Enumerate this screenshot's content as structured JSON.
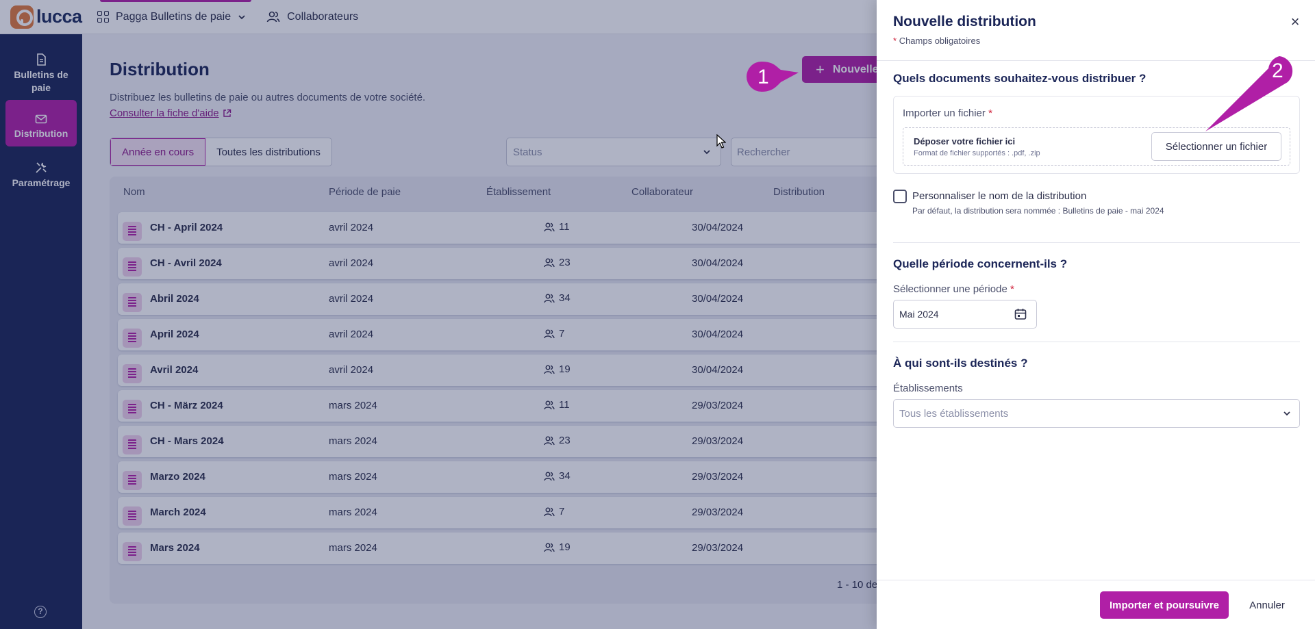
{
  "brand": {
    "logo_text": "lucca"
  },
  "topnav": {
    "app_label": "Pagga Bulletins de paie",
    "collab_label": "Collaborateurs"
  },
  "sidebar": {
    "items": [
      {
        "label": "Bulletins de paie",
        "icon": "document-icon"
      },
      {
        "label": "Distribution",
        "icon": "envelope-icon"
      },
      {
        "label": "Paramétrage",
        "icon": "tools-icon"
      }
    ],
    "help_glyph": "?"
  },
  "page": {
    "title": "Distribution",
    "description": "Distribuez les bulletins de paie ou autres documents de votre société.",
    "help_link": "Consulter la fiche d'aide",
    "new_button": "Nouvelle distribution"
  },
  "filters": {
    "seg_current": "Année en cours",
    "seg_all": "Toutes les distributions",
    "status_placeholder": "Status",
    "search_placeholder": "Rechercher"
  },
  "table": {
    "headers": {
      "name": "Nom",
      "period": "Période de paie",
      "etab": "Établissement",
      "collab": "Collaborateur",
      "dist": "Distribution"
    },
    "rows": [
      {
        "name": "CH - April 2024",
        "period": "avril 2024",
        "collab": "11",
        "dist": "30/04/2024"
      },
      {
        "name": "CH - Avril 2024",
        "period": "avril 2024",
        "collab": "23",
        "dist": "30/04/2024"
      },
      {
        "name": "Abril 2024",
        "period": "avril 2024",
        "collab": "34",
        "dist": "30/04/2024"
      },
      {
        "name": "April 2024",
        "period": "avril 2024",
        "collab": "7",
        "dist": "30/04/2024"
      },
      {
        "name": "Avril 2024",
        "period": "avril 2024",
        "collab": "19",
        "dist": "30/04/2024"
      },
      {
        "name": "CH - März 2024",
        "period": "mars 2024",
        "collab": "11",
        "dist": "29/03/2024"
      },
      {
        "name": "CH - Mars 2024",
        "period": "mars 2024",
        "collab": "23",
        "dist": "29/03/2024"
      },
      {
        "name": "Marzo 2024",
        "period": "mars 2024",
        "collab": "34",
        "dist": "29/03/2024"
      },
      {
        "name": "March 2024",
        "period": "mars 2024",
        "collab": "7",
        "dist": "29/03/2024"
      },
      {
        "name": "Mars 2024",
        "period": "mars 2024",
        "collab": "19",
        "dist": "29/03/2024"
      }
    ],
    "pagination": "1 - 10 de"
  },
  "drawer": {
    "title": "Nouvelle distribution",
    "required_note": "Champs obligatoires",
    "required_star": "*",
    "close_glyph": "×",
    "section_docs": "Quels documents souhaitez-vous distribuer ?",
    "upload_label": "Importer un fichier",
    "drop_title": "Déposer votre fichier ici",
    "drop_formats": "Format de fichier supportés : .pdf, .zip",
    "select_file_button": "Sélectionner un fichier",
    "custom_name_label": "Personnaliser le nom de la distribution",
    "custom_name_hint": "Par défaut, la distribution sera nommée : Bulletins de paie - mai 2024",
    "section_period": "Quelle période concernent-ils ?",
    "period_label": "Sélectionner une période",
    "period_value": "Mai 2024",
    "section_recipients": "À qui sont-ils destinés ?",
    "etab_label": "Établissements",
    "etab_placeholder": "Tous les établissements",
    "primary_button": "Importer et poursuivre",
    "cancel_button": "Annuler"
  },
  "annotations": {
    "step1": "1",
    "step2": "2"
  },
  "colors": {
    "accent": "#b01fa6",
    "sidebar": "#1b2557",
    "required": "#d0213a"
  }
}
